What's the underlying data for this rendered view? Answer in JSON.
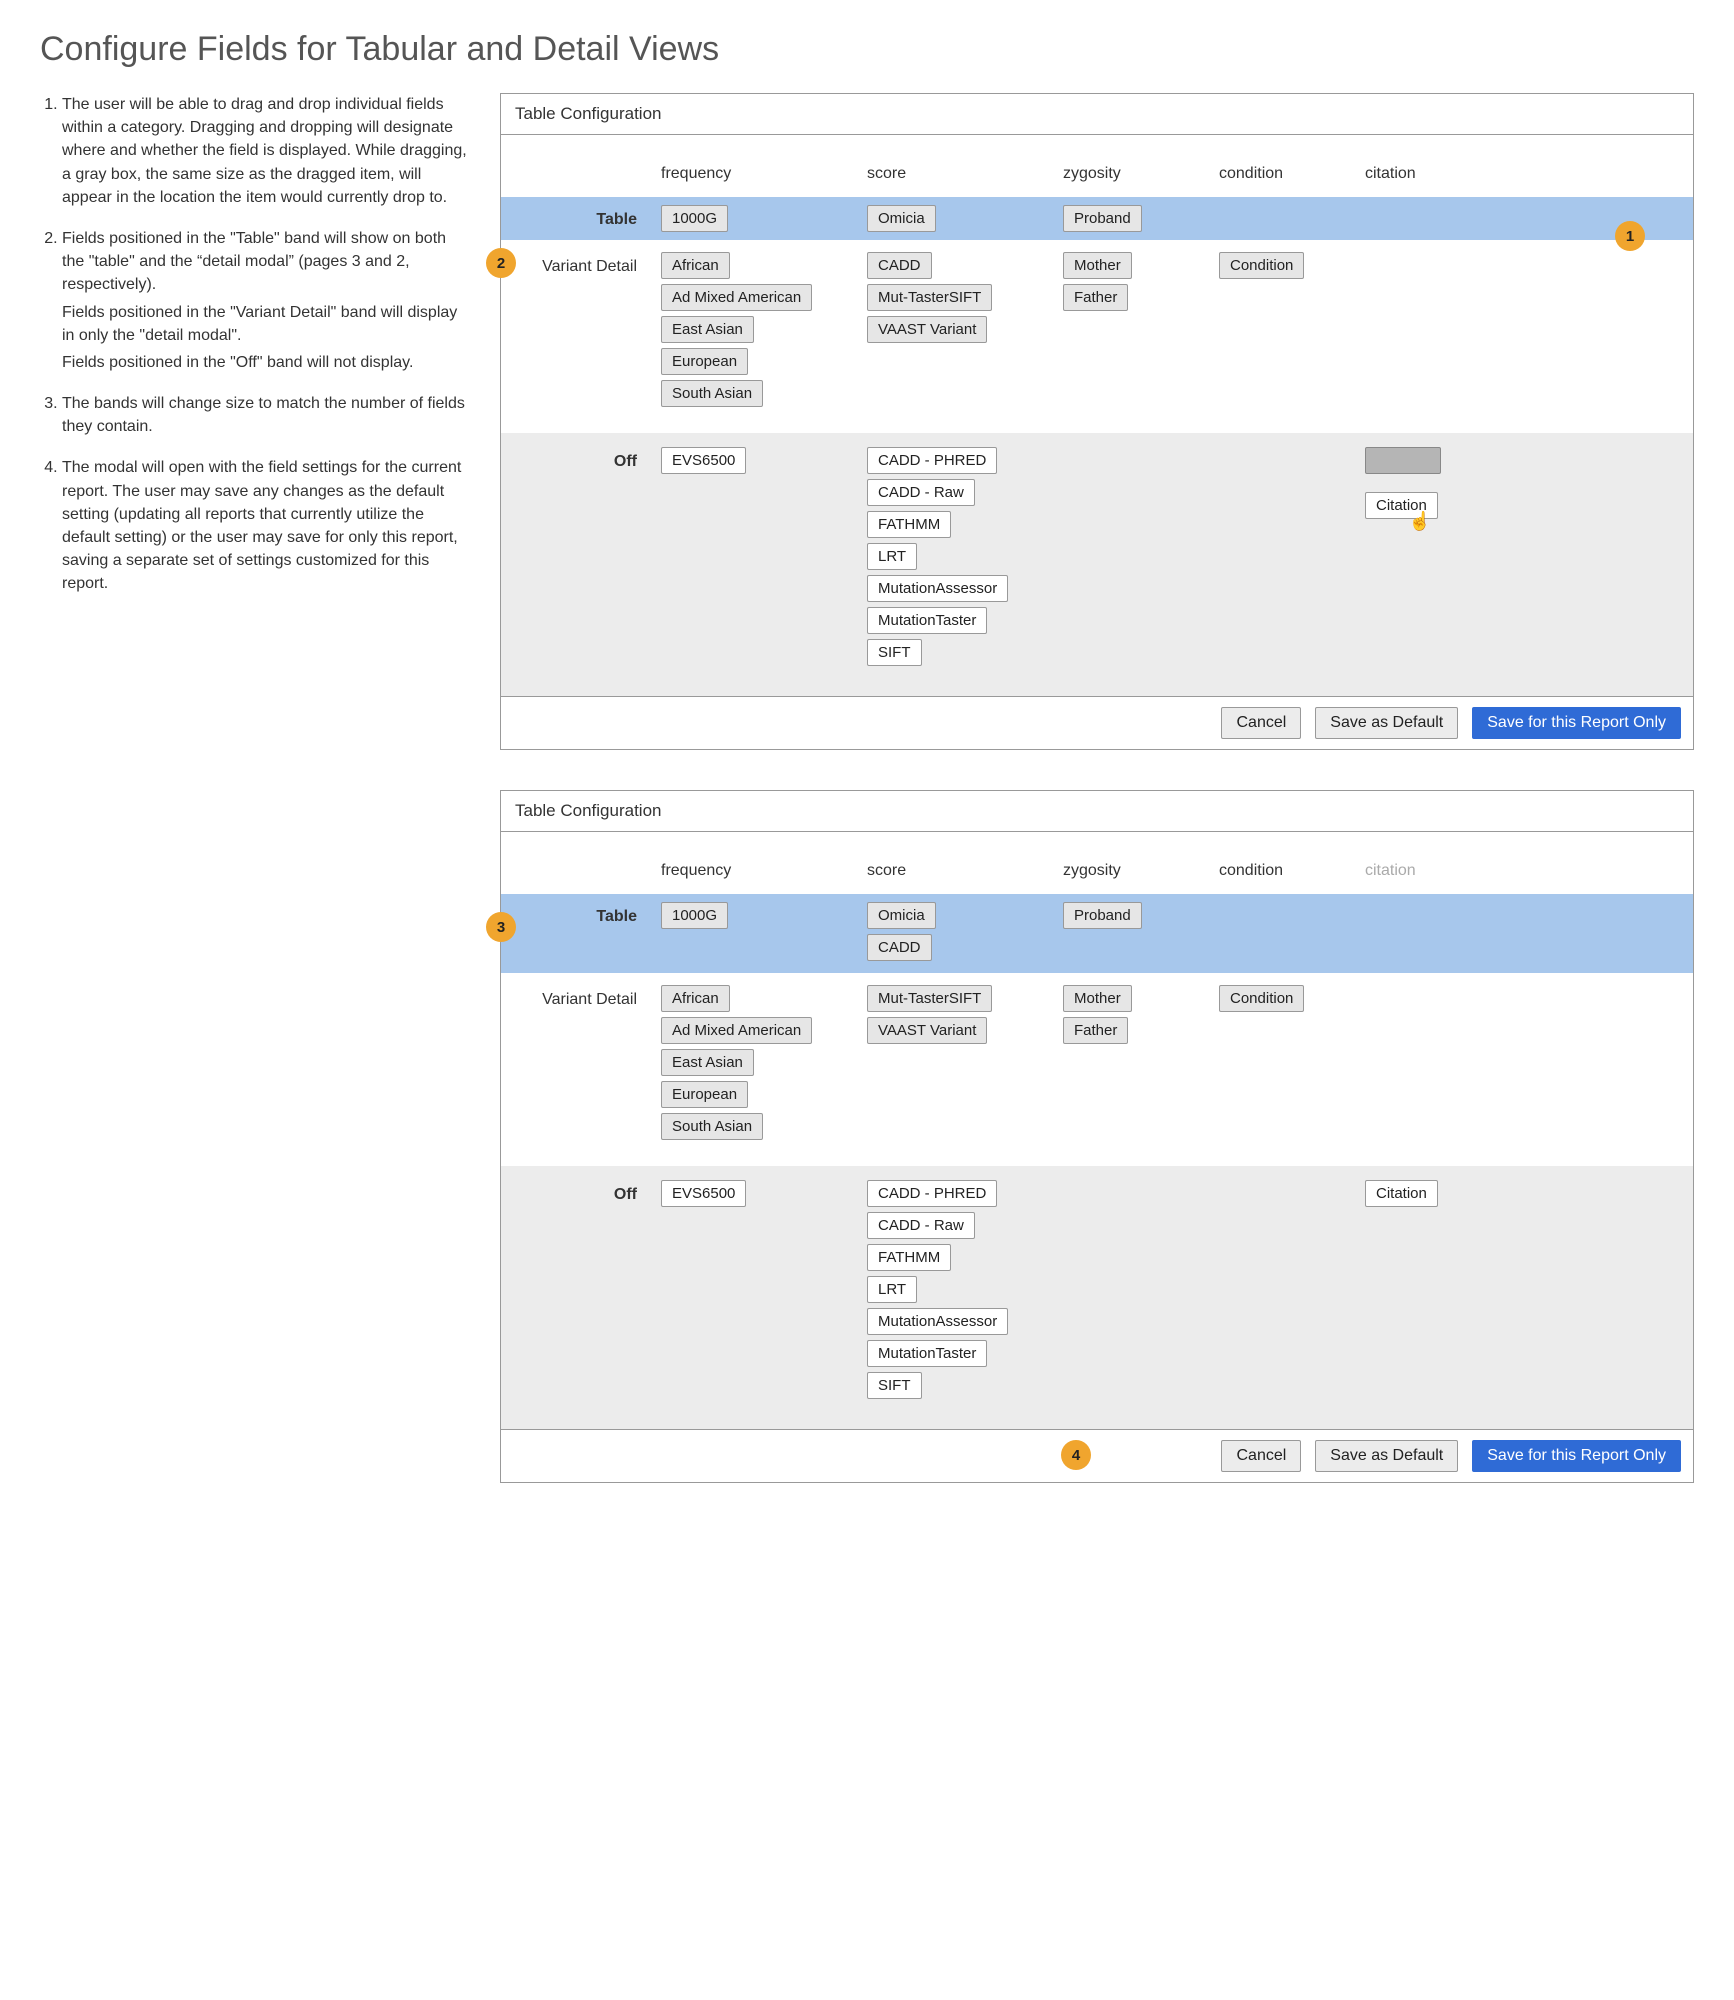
{
  "title": "Configure Fields for Tabular and Detail Views",
  "instructions": {
    "i1": "The user will be able to drag and drop individual fields within a category. Dragging and dropping will designate where and whether the field is displayed. While dragging, a gray box, the same size as the dragged item, will appear in the location the item would currently drop to.",
    "i2a": "Fields positioned in the \"Table\" band will show on both the \"table\" and the “detail modal” (pages 3 and 2, respectively).",
    "i2b": "Fields positioned in the \"Variant Detail\" band will display in only the \"detail modal\".",
    "i2c": "Fields positioned in the \"Off\" band will not display.",
    "i3": "The bands will change size to match the number of fields they contain.",
    "i4": "The modal will open with the field settings for the current report. The user may save any changes as the default setting (updating all reports that currently utilize the default setting) or the user may save for only this report, saving a separate set of settings customized for this report."
  },
  "dialog": {
    "title": "Table Configuration",
    "columns": {
      "frequency": "frequency",
      "score": "score",
      "zygosity": "zygosity",
      "condition": "condition",
      "citation": "citation"
    },
    "bands": {
      "table": "Table",
      "detail": "Variant Detail",
      "off": "Off"
    },
    "footer": {
      "cancel": "Cancel",
      "saveDefault": "Save as Default",
      "saveReport": "Save for this Report Only"
    }
  },
  "annotations": {
    "a1": "1",
    "a2": "2",
    "a3": "3",
    "a4": "4"
  },
  "panel1": {
    "table": {
      "frequency": [
        "1000G"
      ],
      "score": [
        "Omicia"
      ],
      "zygosity": [
        "Proband"
      ],
      "condition": [],
      "citation": []
    },
    "detail": {
      "frequency": [
        "African",
        "Ad Mixed American",
        "East Asian",
        "European",
        "South Asian"
      ],
      "score": [
        "CADD",
        "Mut-TasterSIFT",
        "VAAST Variant"
      ],
      "zygosity": [
        "Mother",
        "Father"
      ],
      "condition": [
        "Condition"
      ],
      "citation": []
    },
    "off": {
      "frequency": [
        "EVS6500"
      ],
      "score": [
        "CADD - PHRED",
        "CADD - Raw",
        "FATHMM",
        "LRT",
        "MutationAssessor",
        "MutationTaster",
        "SIFT"
      ],
      "zygosity": [],
      "condition": [],
      "citation_drag": "Citation"
    }
  },
  "panel2": {
    "table": {
      "frequency": [
        "1000G"
      ],
      "score": [
        "Omicia",
        "CADD"
      ],
      "zygosity": [
        "Proband"
      ],
      "condition": [],
      "citation": []
    },
    "detail": {
      "frequency": [
        "African",
        "Ad Mixed American",
        "East Asian",
        "European",
        "South Asian"
      ],
      "score": [
        "Mut-TasterSIFT",
        "VAAST Variant"
      ],
      "zygosity": [
        "Mother",
        "Father"
      ],
      "condition": [
        "Condition"
      ],
      "citation": []
    },
    "off": {
      "frequency": [
        "EVS6500"
      ],
      "score": [
        "CADD - PHRED",
        "CADD - Raw",
        "FATHMM",
        "LRT",
        "MutationAssessor",
        "MutationTaster",
        "SIFT"
      ],
      "zygosity": [],
      "condition": [],
      "citation": [
        "Citation"
      ]
    }
  }
}
